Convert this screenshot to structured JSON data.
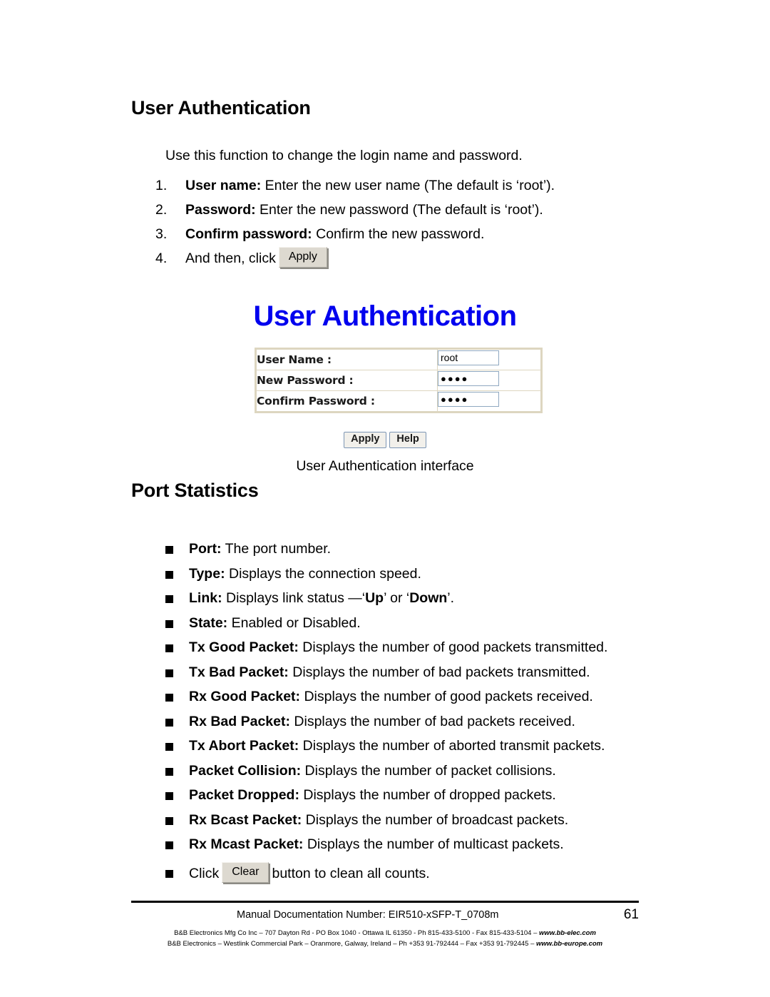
{
  "document": {
    "heading_user_auth": "User Authentication",
    "heading_port_stats": "Port Statistics",
    "intro": "Use this function to change the login name and password."
  },
  "numbered_list": [
    {
      "num": "1.",
      "bold": "User name:",
      "rest": " Enter the new user name (The default is ‘root’)."
    },
    {
      "num": "2.",
      "bold": "Password:",
      "rest": " Enter the new password (The default is ‘root’)."
    },
    {
      "num": "3.",
      "bold": "Confirm password:",
      "rest": " Confirm the new password."
    },
    {
      "num": "4.",
      "bold": "",
      "rest": "And then, click",
      "button": "Apply"
    }
  ],
  "figure": {
    "title": "User Authentication",
    "title_color": "#0000ee",
    "caption": "User Authentication interface",
    "rows": [
      {
        "label": "User Name :",
        "value": "root",
        "masked": false
      },
      {
        "label": "New Password :",
        "value": "●●●●",
        "masked": true
      },
      {
        "label": "Confirm Password :",
        "value": "●●●●",
        "masked": true
      }
    ],
    "buttons": [
      {
        "label": "Apply"
      },
      {
        "label": "Help"
      }
    ]
  },
  "bullet_list": [
    {
      "bold": "Port:",
      "rest": " The port number."
    },
    {
      "bold": "Type:",
      "rest": " Displays the connection speed."
    },
    {
      "bold": "Link:",
      "rest": " Displays link status —‘Up’ or ‘Down’.",
      "rich": true
    },
    {
      "bold": "State:",
      "rest": " Enabled or Disabled."
    },
    {
      "bold": "Tx Good Packet:",
      "rest": " Displays the number of good packets transmitted."
    },
    {
      "bold": "Tx Bad Packet:",
      "rest": " Displays the number of bad packets transmitted."
    },
    {
      "bold": "Rx Good Packet:",
      "rest": " Displays the number of good packets received."
    },
    {
      "bold": "Rx Bad Packet:",
      "rest": " Displays the number of bad packets received."
    },
    {
      "bold": "Tx Abort Packet:",
      "rest": " Displays the number of aborted transmit packets."
    },
    {
      "bold": "Packet Collision:",
      "rest": " Displays the number of packet collisions."
    },
    {
      "bold": "Packet Dropped:",
      "rest": " Displays the number of dropped packets."
    },
    {
      "bold": "Rx Bcast Packet:",
      "rest": " Displays the number of broadcast packets."
    },
    {
      "bold": "Rx Mcast Packet:",
      "rest": " Displays the number of multicast packets."
    },
    {
      "bold": "",
      "rest": "Click",
      "button": "Clear",
      "rest2": "button to clean all counts."
    }
  ],
  "footer": {
    "doc_number": "Manual Documentation Number: EIR510-xSFP-T_0708m",
    "page_number": "61",
    "address_us_plain": "B&B Electronics Mfg Co Inc – 707 Dayton Rd - PO Box 1040 - Ottawa IL 61350 - Ph 815-433-5100 - Fax 815-433-5104 – ",
    "address_us_site": "www.bb-elec.com",
    "address_eu_plain": "B&B Electronics – Westlink Commercial Park – Oranmore, Galway, Ireland – Ph +353 91-792444 – Fax +353 91-792445 – ",
    "address_eu_site": "www.bb-europe.com"
  }
}
